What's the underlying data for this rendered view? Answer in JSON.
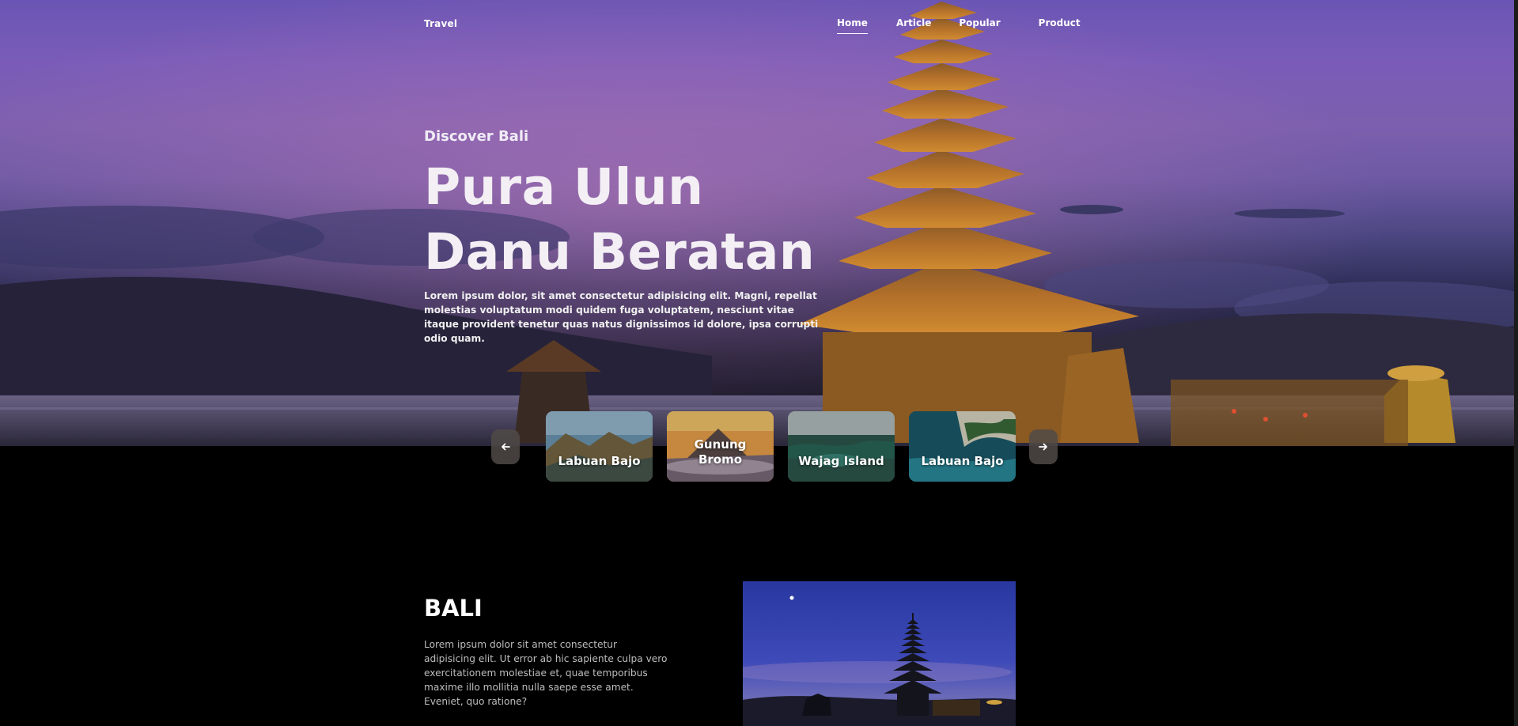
{
  "header": {
    "brand": "Travel",
    "nav": [
      {
        "label": "Home",
        "active": true
      },
      {
        "label": "Article",
        "active": false
      },
      {
        "label": "Popular",
        "active": false
      },
      {
        "label": "Product",
        "active": false
      }
    ]
  },
  "hero": {
    "eyebrow": "Discover Bali",
    "title_line1": "Pura Ulun",
    "title_line2": "Danu Beratan",
    "description": "Lorem ipsum dolor, sit amet consectetur adipisicing elit. Magni, repellat molestias voluptatum modi quidem fuga voluptatem, nesciunt vitae itaque provident tenetur quas natus dignissimos id dolore, ipsa corrupti odio quam."
  },
  "carousel": {
    "prev_icon": "arrow-left-icon",
    "next_icon": "arrow-right-icon",
    "cards": [
      {
        "label": "Labuan Bajo"
      },
      {
        "label": "Gunung Bromo"
      },
      {
        "label": "Wajag Island"
      },
      {
        "label": "Labuan Bajo"
      }
    ]
  },
  "bali": {
    "title": "BALI",
    "description": "Lorem ipsum dolor sit amet consectetur adipisicing elit. Ut error ab hic sapiente culpa vero exercitationem molestiae et, quae temporibus maxime illo mollitia nulla saepe esse amet. Eveniet, quo ratione?"
  },
  "colors": {
    "background": "#000000",
    "sky_top": "#6a55b4",
    "temple_gold": "#c0782a",
    "text": "#ffffff"
  }
}
